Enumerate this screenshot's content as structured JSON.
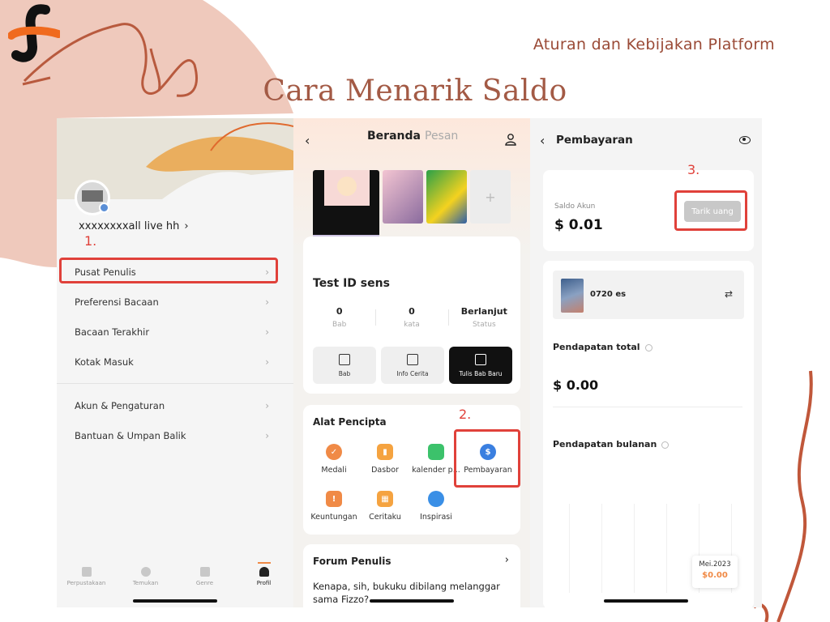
{
  "slide": {
    "header_right": "Aturan dan Kebijakan Platform",
    "title": "Cara Menarik Saldo"
  },
  "colors": {
    "accent_red": "#e0413a",
    "brand_orange": "#f08a46",
    "title_brown": "#a35a45",
    "blob_pink": "#efc9bc"
  },
  "steps": [
    "1.",
    "2.",
    "3."
  ],
  "profile_screen": {
    "username": "xxxxxxxxall live hh",
    "menu": [
      {
        "label": "Pusat Penulis"
      },
      {
        "label": "Preferensi Bacaan"
      },
      {
        "label": "Bacaan Terakhir"
      },
      {
        "label": "Kotak Masuk"
      },
      {
        "label": "Akun & Pengaturan"
      },
      {
        "label": "Bantuan & Umpan Balik"
      }
    ],
    "nav": [
      {
        "label": "Perpustakaan",
        "icon": "library-icon"
      },
      {
        "label": "Temukan",
        "icon": "compass-icon"
      },
      {
        "label": "Genre",
        "icon": "grid-icon"
      },
      {
        "label": "Profil",
        "icon": "profile-icon",
        "active": true
      }
    ]
  },
  "home_screen": {
    "tabs": [
      "Beranda",
      "Pesan"
    ],
    "book_title": "Test ID sens",
    "stats": [
      {
        "value": "0",
        "label": "Bab"
      },
      {
        "value": "0",
        "label": "kata"
      },
      {
        "value": "Berlanjut",
        "label": "Status"
      }
    ],
    "actions": [
      {
        "label": "Bab",
        "icon": "document-icon"
      },
      {
        "label": "Info Cerita",
        "icon": "book-icon"
      },
      {
        "label": "Tulis Bab Baru",
        "icon": "edit-icon"
      }
    ],
    "tools_title": "Alat Pencipta",
    "tools": [
      {
        "label": "Medali",
        "icon": "medal-icon",
        "color": "#f08a46"
      },
      {
        "label": "Dasbor",
        "icon": "dashboard-icon",
        "color": "#f5a340"
      },
      {
        "label": "kalender p...",
        "icon": "calendar-icon",
        "color": "#3cc26b"
      },
      {
        "label": "Pembayaran",
        "icon": "dollar-icon",
        "color": "#3a7fe0"
      },
      {
        "label": "Keuntungan",
        "icon": "gift-icon",
        "color": "#f08a46"
      },
      {
        "label": "Ceritaku",
        "icon": "story-icon",
        "color": "#f5a340"
      },
      {
        "label": "Inspirasi",
        "icon": "bulb-icon",
        "color": "#3a8fe6"
      }
    ],
    "forum_title": "Forum Penulis",
    "forum_text": "Kenapa, sih, bukuku dibilang melanggar sama Fizzo?"
  },
  "payment_screen": {
    "title": "Pembayaran",
    "saldo_label": "Saldo Akun",
    "saldo_value": "$ 0.01",
    "withdraw_button": "Tarik uang",
    "account_name": "0720 es",
    "total_label": "Pendapatan total",
    "total_value": "$ 0.00",
    "monthly_label": "Pendapatan bulanan",
    "tooltip_month": "Mei.2023",
    "tooltip_value": "$0.00"
  }
}
